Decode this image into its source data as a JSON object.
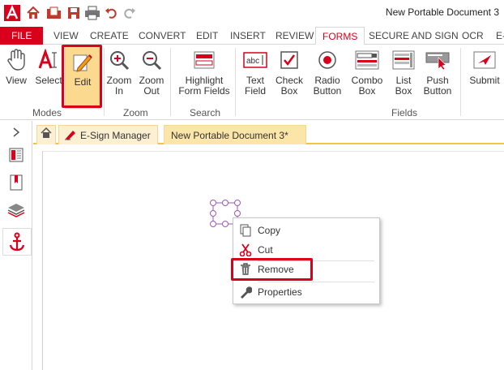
{
  "window": {
    "title": "New Portable Document 3"
  },
  "quick_access": {
    "icons": [
      "app-logo-icon",
      "home-icon",
      "open-folder-icon",
      "save-icon",
      "print-icon",
      "undo-icon",
      "redo-icon"
    ]
  },
  "tabs": [
    {
      "label": "FILE"
    },
    {
      "label": "VIEW"
    },
    {
      "label": "CREATE"
    },
    {
      "label": "CONVERT"
    },
    {
      "label": "EDIT"
    },
    {
      "label": "INSERT"
    },
    {
      "label": "REVIEW"
    },
    {
      "label": "FORMS"
    },
    {
      "label": "SECURE AND SIGN"
    },
    {
      "label": "OCR"
    },
    {
      "label": "E-"
    }
  ],
  "active_tab": "FORMS",
  "ribbon": {
    "view": "View",
    "select": "Select",
    "edit": "Edit",
    "zoom_in_1": "Zoom",
    "zoom_in_2": "In",
    "zoom_out_1": "Zoom",
    "zoom_out_2": "Out",
    "highlight_1": "Highlight",
    "highlight_2": "Form Fields",
    "text_field_1": "Text",
    "text_field_2": "Field",
    "check_box_1": "Check",
    "check_box_2": "Box",
    "radio_1": "Radio",
    "radio_2": "Button",
    "combo_1": "Combo",
    "combo_2": "Box",
    "list_1": "List",
    "list_2": "Box",
    "push_1": "Push",
    "push_2": "Button",
    "submit": "Submit",
    "groups": {
      "modes": "Modes",
      "zoom": "Zoom",
      "search": "Search",
      "fields": "Fields"
    }
  },
  "doc_tabs": {
    "home_icon": "home-icon",
    "esign": "E-Sign Manager",
    "document": "New Portable Document 3*",
    "close": "×"
  },
  "context_menu": {
    "copy": "Copy",
    "cut": "Cut",
    "remove": "Remove",
    "properties": "Properties"
  },
  "colors": {
    "accent": "#d9001b",
    "doc_tab": "#fbe5a8",
    "highlight_edit": "#fbd98f",
    "selection": "#9b59b6"
  }
}
